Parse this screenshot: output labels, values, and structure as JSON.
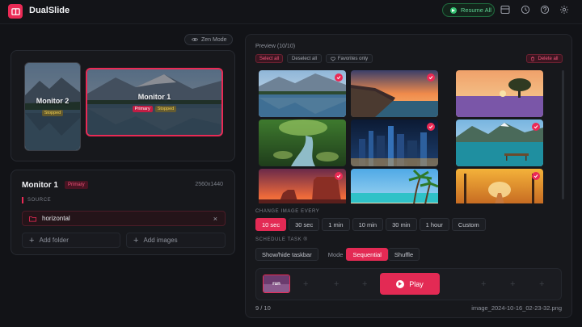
{
  "app": {
    "name": "DualSlide",
    "resume_label": "Resume All"
  },
  "toolbar_icons": [
    "layout-icon",
    "history-icon",
    "help-icon",
    "settings-icon"
  ],
  "zen_mode_label": "Zen Mode",
  "monitors": [
    {
      "name": "Monitor 2",
      "status": "Stopped"
    },
    {
      "name": "Monitor 1",
      "primary": "Primary",
      "status": "Stopped"
    }
  ],
  "config": {
    "title": "Monitor 1",
    "badge": "Primary",
    "resolution": "2560x1440",
    "source_label": "SOURCE",
    "source_folder": "horizontal",
    "remove_symbol": "×",
    "add_folder": "Add folder",
    "add_images": "Add images"
  },
  "preview": {
    "title": "Preview",
    "count": "(10/10)",
    "select_all": "Select all",
    "deselect_all": "Deselect all",
    "favorites_only": "Favorites only",
    "delete_all": "Delete all",
    "thumbnails": [
      "lake-mountains",
      "coast-sunset",
      "lavender-tree",
      "forest-stream",
      "city-night",
      "alpine-lake-dock",
      "desert-sunset",
      "tropical-beach",
      "autumn-road"
    ]
  },
  "change_image": {
    "label": "CHANGE IMAGE EVERY",
    "options": [
      "10 sec",
      "30 sec",
      "1 min",
      "10 min",
      "30 min",
      "1 hour",
      "Custom"
    ],
    "selected": "10 sec"
  },
  "schedule": {
    "label": "SCHEDULE TASK",
    "info_symbol": "®",
    "taskbar_label": "Show/hide taskbar",
    "mode_label": "Mode",
    "modes": [
      "Sequential",
      "Shuffle"
    ],
    "selected_mode": "Sequential"
  },
  "player": {
    "run_label": "run",
    "play_label": "Play",
    "slot_symbol": "+"
  },
  "footer": {
    "counter": "9 / 10",
    "filename": "image_2024-10-16_02-23-32.png"
  },
  "colors": {
    "accent": "#e32a54",
    "background": "#121317",
    "panel": "#17181c",
    "success": "#35c272"
  }
}
